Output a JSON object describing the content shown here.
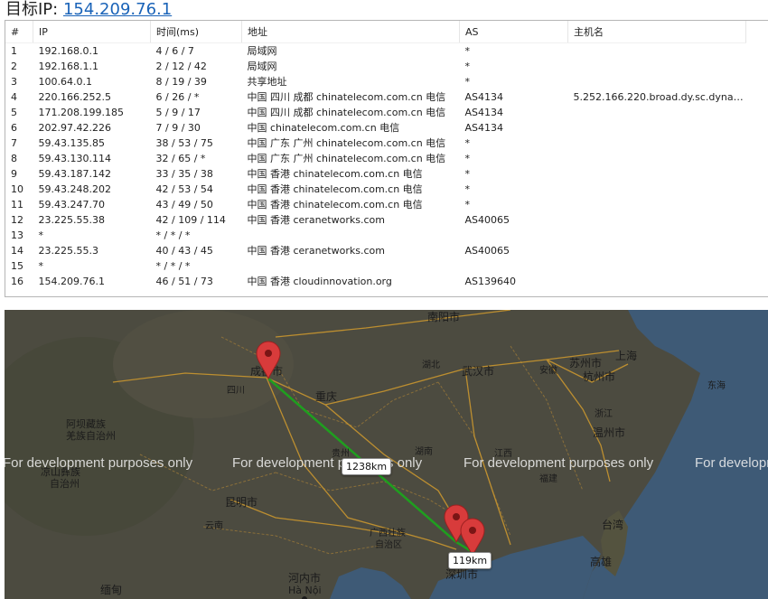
{
  "header": {
    "label": "目标IP:",
    "target_ip": "154.209.76.1"
  },
  "table": {
    "columns": [
      "#",
      "IP",
      "时间(ms)",
      "地址",
      "AS",
      "主机名"
    ],
    "rows": [
      {
        "num": "1",
        "ip": "192.168.0.1",
        "time": "4 / 6 / 7",
        "addr": "局域网",
        "as": "*",
        "host": ""
      },
      {
        "num": "2",
        "ip": "192.168.1.1",
        "time": "2 / 12 / 42",
        "addr": "局域网",
        "as": "*",
        "host": ""
      },
      {
        "num": "3",
        "ip": "100.64.0.1",
        "time": "8 / 19 / 39",
        "addr": "共享地址",
        "as": "*",
        "host": ""
      },
      {
        "num": "4",
        "ip": "220.166.252.5",
        "time": "6 / 26 / *",
        "addr": "中国 四川 成都 chinatelecom.com.cn 电信",
        "as": "AS4134",
        "host": "5.252.166.220.broad.dy.sc.dynami..."
      },
      {
        "num": "5",
        "ip": "171.208.199.185",
        "time": "5 / 9 / 17",
        "addr": "中国 四川 成都 chinatelecom.com.cn 电信",
        "as": "AS4134",
        "host": ""
      },
      {
        "num": "6",
        "ip": "202.97.42.226",
        "time": "7 / 9 / 30",
        "addr": "中国 chinatelecom.com.cn 电信",
        "as": "AS4134",
        "host": ""
      },
      {
        "num": "7",
        "ip": "59.43.135.85",
        "time": "38 / 53 / 75",
        "addr": "中国 广东 广州 chinatelecom.com.cn 电信",
        "as": "*",
        "host": ""
      },
      {
        "num": "8",
        "ip": "59.43.130.114",
        "time": "32 / 65 / *",
        "addr": "中国 广东 广州 chinatelecom.com.cn 电信",
        "as": "*",
        "host": ""
      },
      {
        "num": "9",
        "ip": "59.43.187.142",
        "time": "33 / 35 / 38",
        "addr": "中国 香港 chinatelecom.com.cn 电信",
        "as": "*",
        "host": ""
      },
      {
        "num": "10",
        "ip": "59.43.248.202",
        "time": "42 / 53 / 54",
        "addr": "中国 香港 chinatelecom.com.cn 电信",
        "as": "*",
        "host": ""
      },
      {
        "num": "11",
        "ip": "59.43.247.70",
        "time": "43 / 49 / 50",
        "addr": "中国 香港 chinatelecom.com.cn 电信",
        "as": "*",
        "host": ""
      },
      {
        "num": "12",
        "ip": "23.225.55.38",
        "time": "42 / 109 / 114",
        "addr": "中国 香港 ceranetworks.com",
        "as": "AS40065",
        "host": ""
      },
      {
        "num": "13",
        "ip": "*",
        "time": "* / * / *",
        "addr": "",
        "as": "",
        "host": ""
      },
      {
        "num": "14",
        "ip": "23.225.55.3",
        "time": "40 / 43 / 45",
        "addr": "中国 香港 ceranetworks.com",
        "as": "AS40065",
        "host": ""
      },
      {
        "num": "15",
        "ip": "*",
        "time": "* / * / *",
        "addr": "",
        "as": "",
        "host": ""
      },
      {
        "num": "16",
        "ip": "154.209.76.1",
        "time": "46 / 51 / 73",
        "addr": "中国 香港 cloudinnovation.org",
        "as": "AS139640",
        "host": ""
      }
    ]
  },
  "map": {
    "watermark": "For development purposes only",
    "route_distance_1": "1238km",
    "route_distance_2": "119km",
    "labels": {
      "nanyang": "南阳市",
      "shanghai": "上海",
      "chengdu": "成都市",
      "sichuan": "四川",
      "hubei": "湖北",
      "wuhan": "武汉市",
      "anhui": "安徽",
      "suzhou": "苏州市",
      "hangzhou": "杭州市",
      "donghai": "东海",
      "chongqing": "重庆",
      "zhejiang": "浙江",
      "aba": "阿坝藏族",
      "aba2": "羌族自治州",
      "wenzhou": "温州市",
      "guizhou": "贵州",
      "hunan": "湖南",
      "jiangxi": "江西",
      "fujian": "福建",
      "liangshan": "凉山彝族",
      "liangshan2": "自治州",
      "kunming": "昆明市",
      "yunnan": "云南",
      "guangxi": "广西壮族",
      "guangxi2": "自治区",
      "taiwan": "台湾",
      "gaoxiong": "高雄",
      "shenzhen": "深圳市",
      "hanoi": "河内市",
      "hanoi_en": "Hà Nội",
      "myanmar": "缅甸"
    },
    "colors": {
      "route": "#1f9e1f",
      "pin": "#d83b3b",
      "land": "#4c4b40",
      "sea": "#3e5a76"
    }
  }
}
